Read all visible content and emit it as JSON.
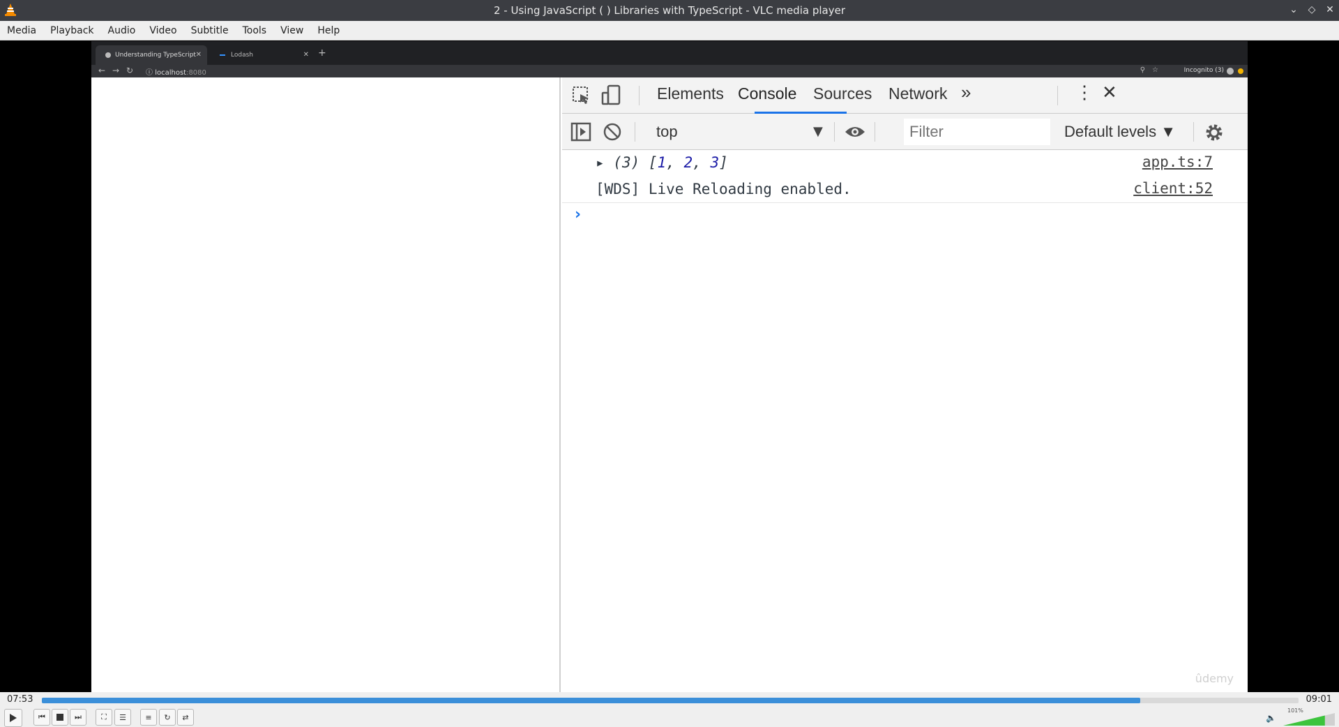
{
  "window": {
    "title": "2 - Using JavaScript ( ) Libraries with TypeScript - VLC media player"
  },
  "menubar": [
    "Media",
    "Playback",
    "Audio",
    "Video",
    "Subtitle",
    "Tools",
    "View",
    "Help"
  ],
  "browser": {
    "tabs": [
      {
        "label": "Understanding TypeScript",
        "active": true
      },
      {
        "label": "Lodash",
        "active": false
      }
    ],
    "url_host": "localhost",
    "url_port": ":8080",
    "incognito_label": "Incognito (3)"
  },
  "devtools": {
    "tabs": [
      "Elements",
      "Console",
      "Sources",
      "Network"
    ],
    "active_tab": "Console",
    "context": "top",
    "filter_placeholder": "Filter",
    "levels": "Default levels",
    "messages": [
      {
        "count": "(3)",
        "open": "[",
        "items": [
          "1",
          "2",
          "3"
        ],
        "close": "]",
        "source": "app.ts:7"
      },
      {
        "text": "[WDS] Live Reloading enabled.",
        "source": "client:52"
      }
    ],
    "watermark": "ûdemy"
  },
  "player": {
    "elapsed": "07:53",
    "total": "09:01",
    "progress": 0.874,
    "volume_label": "101%",
    "volume": 1.01
  },
  "colors": {
    "accent": "#1a73e8",
    "seek_fill": "#3b8fd9",
    "volume_fill": "#3cc43c"
  }
}
